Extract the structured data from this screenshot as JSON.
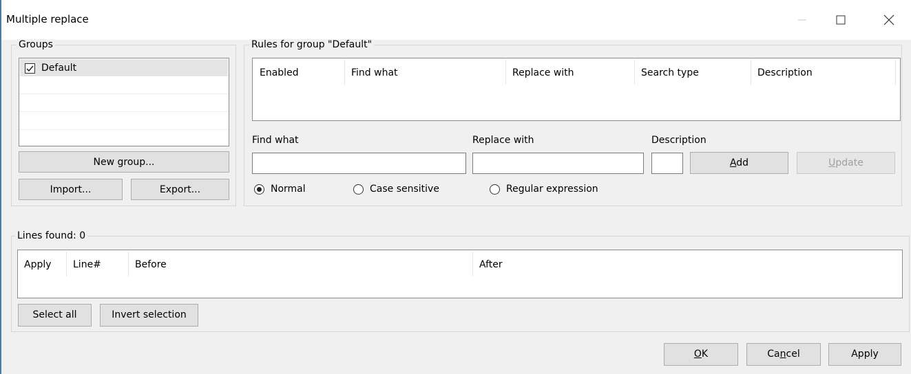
{
  "window": {
    "title": "Multiple replace"
  },
  "groups": {
    "label": "Groups",
    "items": [
      {
        "label": "Default",
        "checked": true
      }
    ],
    "new_group": "New group...",
    "import": "Import...",
    "export": "Export..."
  },
  "rules": {
    "label": "Rules for group \"Default\"",
    "columns": [
      "Enabled",
      "Find what",
      "Replace with",
      "Search type",
      "Description"
    ],
    "find_label": "Find what",
    "replace_label": "Replace with",
    "desc_label": "Description",
    "find_value": "",
    "replace_value": "",
    "desc_value": "",
    "add_pre": "",
    "add_key": "A",
    "add_post": "dd",
    "update_pre": "",
    "update_key": "U",
    "update_post": "pdate",
    "radios": [
      {
        "label": "Normal",
        "selected": true
      },
      {
        "label": "Case sensitive",
        "selected": false
      },
      {
        "label": "Regular expression",
        "selected": false
      }
    ]
  },
  "lines": {
    "label": "Lines found: 0",
    "columns": [
      "Apply",
      "Line#",
      "Before",
      "After"
    ],
    "select_all": "Select all",
    "invert": "Invert selection"
  },
  "footer": {
    "ok_pre": "",
    "ok_key": "O",
    "ok_post": "K",
    "cancel_pre": "Ca",
    "cancel_key": "n",
    "cancel_post": "cel",
    "apply": "Apply"
  },
  "icons": {
    "check": "checkmark-icon",
    "minimize": "minimize-icon",
    "maximize": "maximize-icon",
    "close": "close-icon"
  }
}
